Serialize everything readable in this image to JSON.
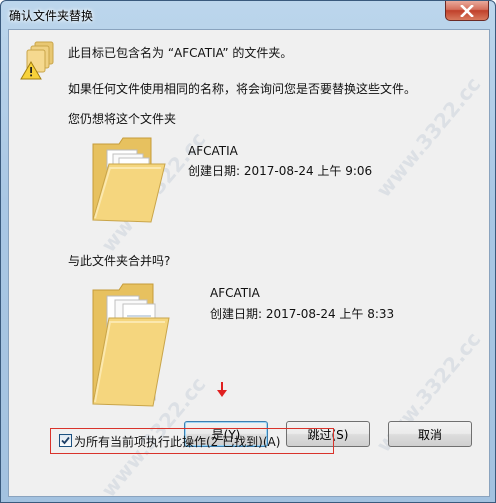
{
  "window": {
    "title": "确认文件夹替换",
    "close_icon": "close-icon"
  },
  "message": {
    "line1": "此目标已包含名为 “AFCATIA” 的文件夹。",
    "line2": "如果任何文件使用相同的名称，将会询问您是否要替换这些文件。",
    "line3": "您仍想将这个文件夹"
  },
  "source_folder": {
    "name": "AFCATIA",
    "created": "创建日期: 2017-08-24 上午 9:06"
  },
  "merge_question": "与此文件夹合并吗?",
  "target_folder": {
    "name": "AFCATIA",
    "created": "创建日期: 2017-08-24 上午 8:33"
  },
  "buttons": {
    "yes": "是(Y)",
    "skip": "跳过(S)",
    "cancel": "取消"
  },
  "apply_all": {
    "label": "为所有当前项执行此操作(2 已找到)(A)",
    "checked": true
  },
  "watermark": "www.3322.cc",
  "colors": {
    "title_gradient": "#a9c7e4",
    "client_bg": "#f0f0f0",
    "highlight_red": "#d9332b",
    "folder_yellow": "#f5d67e"
  }
}
